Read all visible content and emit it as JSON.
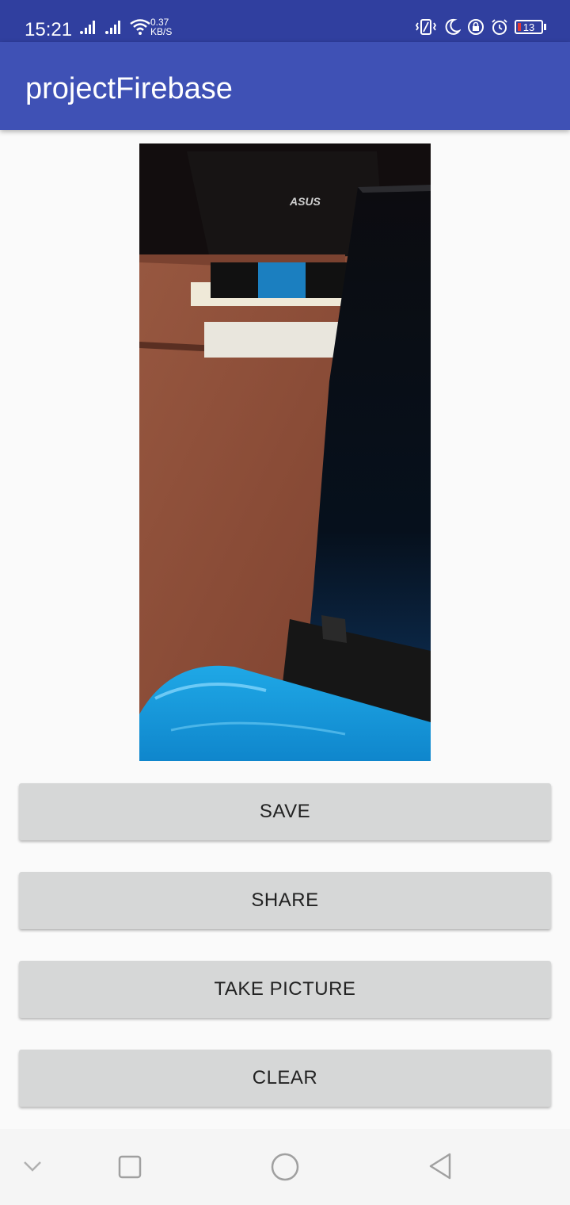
{
  "status_bar": {
    "time": "15:21",
    "net_speed_value": "0.37",
    "net_speed_unit": "KB/S",
    "battery_level": "13",
    "icons": [
      "signal-icon",
      "signal-icon",
      "wifi-icon",
      "vibrate-icon",
      "moon-icon",
      "rotation-lock-icon",
      "alarm-icon",
      "battery-icon"
    ],
    "battery_low_color": "#e53935"
  },
  "app_bar": {
    "title": "projectFirebase",
    "color": "#3f51b5",
    "status_color": "#303f9f"
  },
  "main": {
    "photo_icon": "captured-photo",
    "buttons": [
      {
        "label": "SAVE"
      },
      {
        "label": "SHARE"
      },
      {
        "label": "TAKE PICTURE"
      },
      {
        "label": "CLEAR"
      }
    ],
    "button_color": "#d6d7d7"
  },
  "nav_bar": {
    "icons": [
      "chevron-down-icon",
      "recents-icon",
      "home-icon",
      "back-icon"
    ]
  }
}
